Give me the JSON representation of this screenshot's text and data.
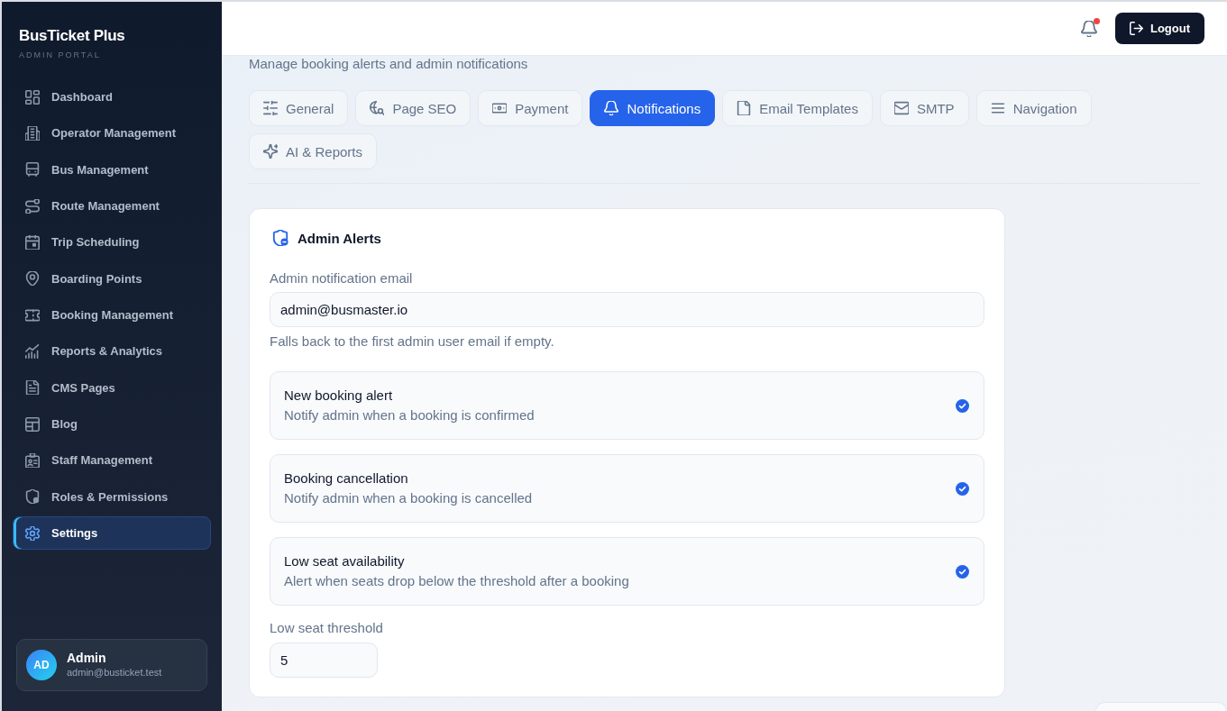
{
  "sidebar": {
    "brand": "BusTicket Plus",
    "tagline": "ADMIN PORTAL",
    "items": [
      {
        "label": "Dashboard",
        "selected": false
      },
      {
        "label": "Operator Management",
        "selected": false
      },
      {
        "label": "Bus Management",
        "selected": false
      },
      {
        "label": "Route Management",
        "selected": false
      },
      {
        "label": "Trip Scheduling",
        "selected": false
      },
      {
        "label": "Boarding Points",
        "selected": false
      },
      {
        "label": "Booking Management",
        "selected": false
      },
      {
        "label": "Reports & Analytics",
        "selected": false
      },
      {
        "label": "CMS Pages",
        "selected": false
      },
      {
        "label": "Blog",
        "selected": false
      },
      {
        "label": "Staff Management",
        "selected": false
      },
      {
        "label": "Roles & Permissions",
        "selected": false
      },
      {
        "label": "Settings",
        "selected": true
      }
    ],
    "user": {
      "initials": "AD",
      "name": "Admin",
      "email": "admin@busticket.test"
    }
  },
  "header": {
    "notifications": {
      "unread": true
    },
    "logout": "Logout"
  },
  "page": {
    "subtitle": "Manage booking alerts and admin notifications"
  },
  "tabs": [
    {
      "label": "General",
      "selected": false
    },
    {
      "label": "Page SEO",
      "selected": false
    },
    {
      "label": "Payment",
      "selected": false
    },
    {
      "label": "Notifications",
      "selected": true
    },
    {
      "label": "Email Templates",
      "selected": false
    },
    {
      "label": "SMTP",
      "selected": false
    },
    {
      "label": "Navigation",
      "selected": false
    },
    {
      "label": "AI & Reports",
      "selected": false
    }
  ],
  "card": {
    "title": "Admin Alerts",
    "email_field": {
      "label": "Admin notification email",
      "value": "admin@busmaster.io",
      "hint": "Falls back to the first admin user email if empty."
    },
    "alerts": [
      {
        "title": "New booking alert",
        "description": "Notify admin when a booking is confirmed",
        "checked": true
      },
      {
        "title": "Booking cancellation",
        "description": "Notify admin when a booking is cancelled",
        "checked": true
      },
      {
        "title": "Low seat availability",
        "description": "Alert when seats drop below the threshold after a booking",
        "checked": true
      }
    ],
    "threshold_field": {
      "label": "Low seat threshold",
      "value": "5"
    }
  }
}
